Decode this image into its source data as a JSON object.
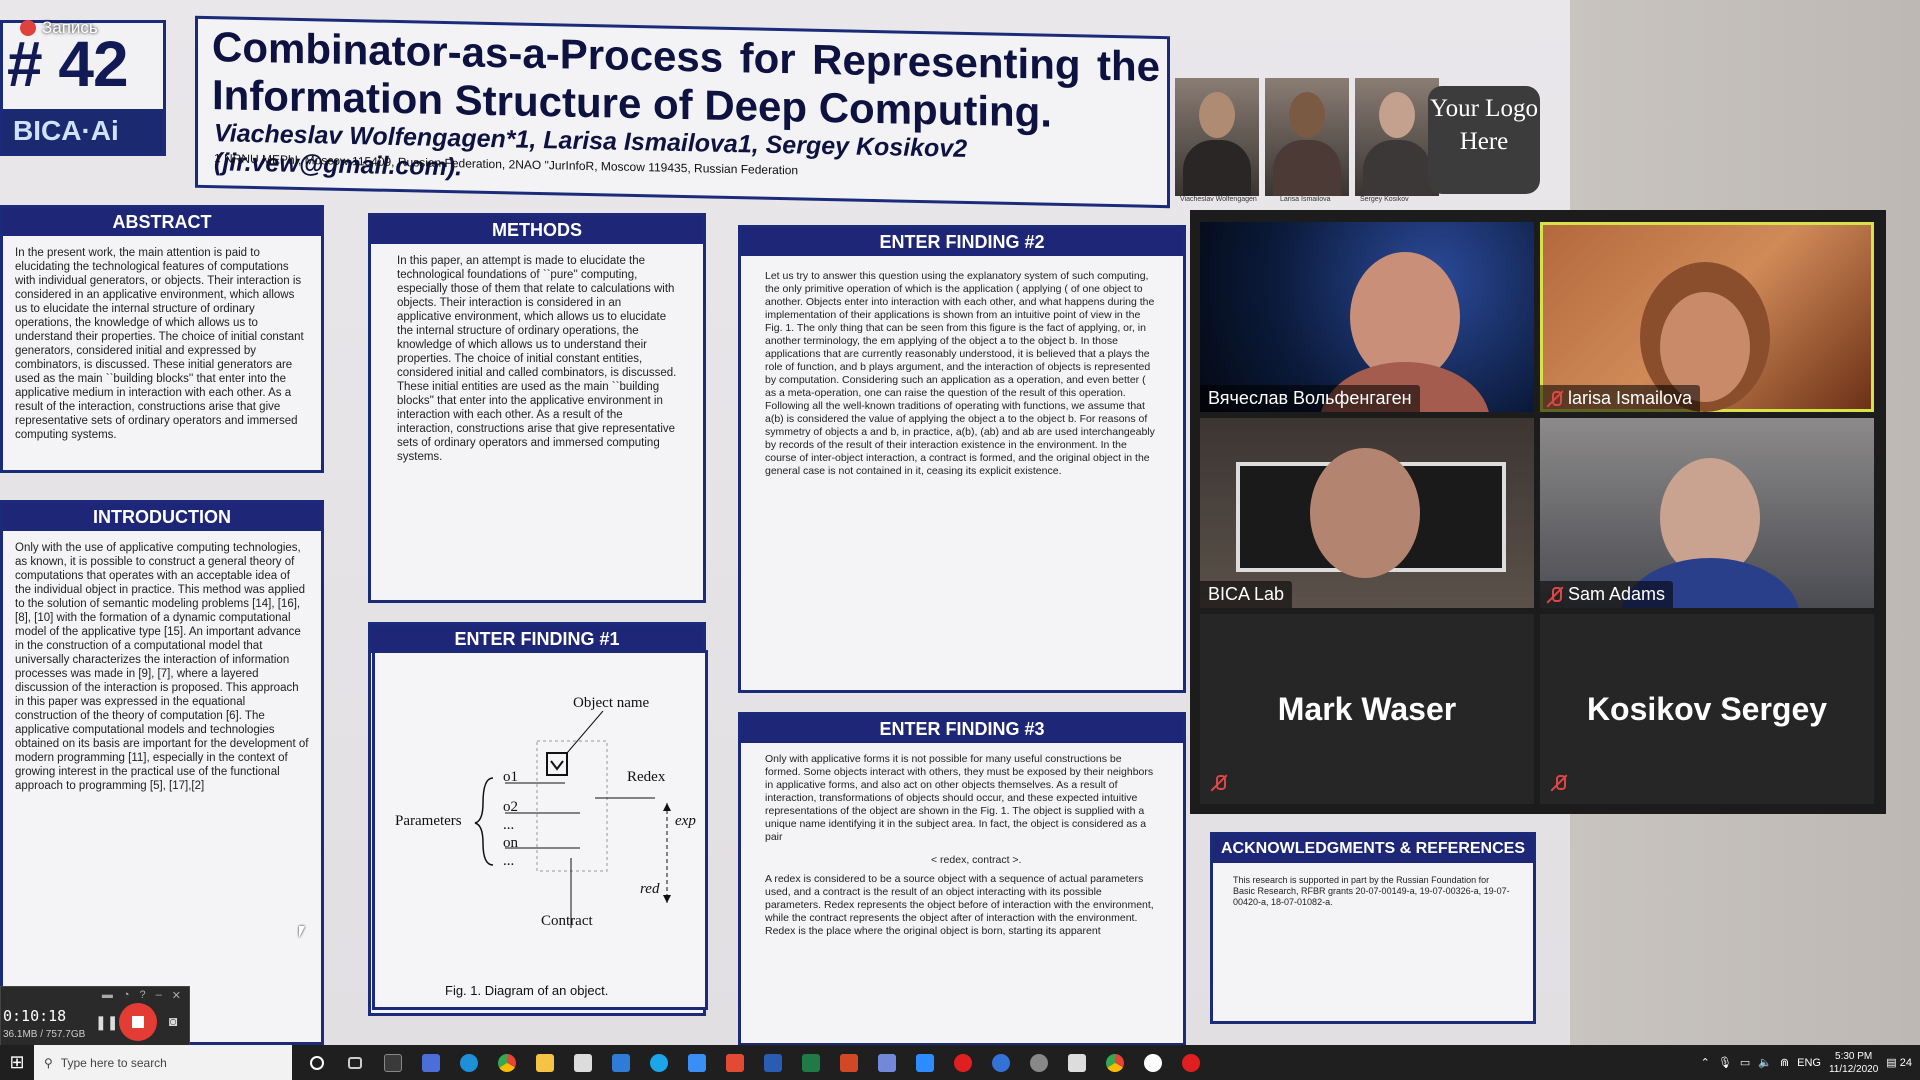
{
  "recording": {
    "label": "Запись"
  },
  "poster": {
    "number": "# 42",
    "bica_logo": "BICA·Ai",
    "title": "Combinator-as-a-Process for Representing the Information Structure of Deep Computing.",
    "authors": "Viacheslav Wolfengagen*1, Larisa Ismailova1, Sergey Kosikov2 (jir.vew@gmail.com).",
    "affiliations": "1 NRNU MEPhI, Moscow 115409, Russian Federation, 2NAO \"JurInfoR, Moscow 119435, Russian Federation",
    "photo_captions": [
      "Viacheslav Wolfengagen",
      "Larisa Ismailova",
      "Sergey Kosikov"
    ],
    "logo_placeholder": "Your Logo Here",
    "abstract": {
      "heading": "ABSTRACT",
      "text": "In the present work, the main attention is paid to elucidating the technological features of computations with individual generators, or objects. Their interaction is considered in an applicative environment, which allows us to elucidate the internal structure of ordinary operations, the knowledge of which allows us to understand their properties. The choice of initial constant generators, considered initial and expressed by combinators, is discussed. These initial generators are used as the main ``building blocks'' that enter into the applicative medium in interaction with each other. As a result of the interaction, constructions arise that give representative sets of ordinary operators and immersed computing systems."
    },
    "introduction": {
      "heading": "INTRODUCTION",
      "text": "Only with the use of applicative computing technologies, as known, it is possible to construct a general theory of computations that operates with an acceptable idea of the individual object in practice. This method was applied to the solution of semantic modeling problems [14], [16], [8], [10] with the formation of a dynamic computational model of the applicative type [15]. An important advance in the construction of a computational model that universally characterizes the interaction of information processes was made in [9], [7], where a layered discussion of the interaction is proposed. This approach in this paper was expressed in the equational construction of the theory of computation [6]. The applicative computational models and technologies obtained on its basis are important for the development of modern programming [11], especially in the context of growing interest in the practical use of the functional approach to programming [5], [17],[2]"
    },
    "methods": {
      "heading": "METHODS",
      "text": "In this paper, an attempt is made to elucidate the technological foundations of ``pure'' computing, especially those of them that relate to calculations with objects. Their interaction is considered in an applicative environment, which allows us to elucidate the internal structure of ordinary operations, the knowledge of which allows us to understand their properties. The choice of initial constant entities, considered initial and called combinators, is discussed. These initial entities are used as the main ``building blocks'' that enter into the applicative environment in interaction with each other. As a result of the interaction, constructions arise that give representative sets of ordinary operators and immersed computing systems."
    },
    "finding1": {
      "heading": "ENTER FINDING #1",
      "diagram_labels": [
        "Object name",
        "Parameters",
        "Redex",
        "exp",
        "red",
        "Contract",
        "o1",
        "o2",
        "...",
        "on",
        "..."
      ],
      "caption": "Fig. 1. Diagram of an object."
    },
    "finding2": {
      "heading": "ENTER FINDING #2",
      "text": "Let us try to answer this question using the explanatory system of such computing, the only primitive operation of which is the application ( applying ( of one object to another. Objects enter into interaction with each other, and what happens during the implementation of their applications is shown from an intuitive point of view in the Fig. 1. The only thing that can be seen from this figure is the fact of applying, or, in another terminology, the em applying of the object a to the object b. In those applications that are currently reasonably understood, it is believed that a plays the role of function, and b plays argument, and the interaction of objects is represented by computation. Considering such an application as a operation, and even better ( as a meta-operation, one can raise the question of the result of this operation. Following all the well-known traditions of operating with functions, we assume that a(b) is considered the value of applying the object a to the object b. For reasons of symmetry of objects a and b, in practice, a(b), (ab) and ab are used interchangeably by records of the result of their interaction existence in the environment. In the course of inter-object interaction, a contract is formed, and the original object in the general case is not contained in it, ceasing its explicit existence."
    },
    "finding3": {
      "heading": "ENTER FINDING #3",
      "text": "Only with applicative forms it is not possible for many useful constructions be formed. Some objects interact with others, they must be exposed by their neighbors in applicative forms, and also act on other objects themselves. As a result of interaction, transformations of objects should occur, and these expected intuitive representations of the object are shown in the Fig. 1. The object is supplied with a unique name identifying it in the subject area. In fact, the object is considered as a pair",
      "pair": "< redex, contract >.",
      "text2": "A redex is considered to be a source object with a sequence of actual parameters used, and a contract is the result of an object interacting with its possible parameters. Redex represents the object before of interaction with the environment, while the contract represents the object after of interaction with the environment. Redex is the place where the original object is born, starting its apparent"
    },
    "acknowledgments": {
      "heading": "ACKNOWLEDGMENTS & REFERENCES",
      "text": "This research is supported in part by the Russian Foundation for Basic Research, RFBR grants 20-07-00149-a, 19-07-00326-a, 19-07-00420-a, 18-07-01082-a."
    }
  },
  "zoom": {
    "participants": [
      {
        "name": "Вячеслав Вольфенгаген",
        "muted": false,
        "active": false
      },
      {
        "name": "larisa Ismailova",
        "muted": true,
        "active": true
      },
      {
        "name": "BICA Lab",
        "muted": false,
        "active": false
      },
      {
        "name": "Sam Adams",
        "muted": true,
        "active": false
      },
      {
        "name": "Mark Waser",
        "muted": true,
        "active": false,
        "video": false
      },
      {
        "name": "Kosikov Sergey",
        "muted": true,
        "active": false,
        "video": false
      }
    ],
    "active_color": "#d8e04a"
  },
  "recorder": {
    "time": "0:10:18",
    "size": "36.1MB / 757.7GB"
  },
  "taskbar": {
    "search_placeholder": "Type here to search",
    "language": "ENG",
    "time": "5:30 PM",
    "date": "11/12/2020",
    "notifications": "24",
    "app_icons": [
      "cortana",
      "task-view",
      "app-1",
      "save",
      "edge",
      "chrome",
      "explorer",
      "store",
      "mail",
      "skype",
      "dropbox",
      "acrobat",
      "word",
      "excel",
      "powerpoint",
      "discord",
      "zoom",
      "record",
      "app-b",
      "app-c",
      "app-d",
      "chrome-2",
      "app-e",
      "record-2"
    ]
  }
}
